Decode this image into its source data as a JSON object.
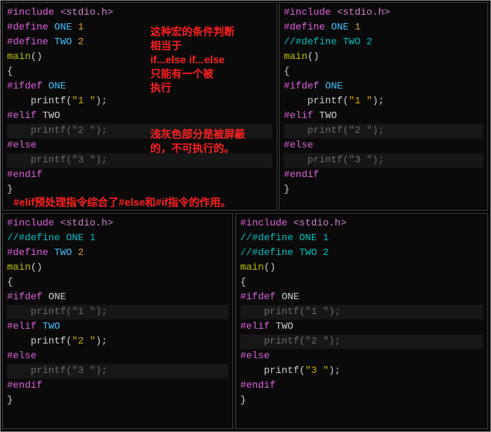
{
  "panel1": {
    "l0_kw": "#include",
    "l0_inc": " <stdio.h>",
    "l1_kw": "#define",
    "l1_mac": " ONE",
    "l1_val": " 1",
    "l2_kw": "#define",
    "l2_mac": " TWO",
    "l2_val": " 2",
    "l3_fn": "main",
    "l3_paren": "()",
    "l4": "{",
    "l5_kw": "#ifdef",
    "l5_mac": " ONE",
    "l6_call": "    printf(",
    "l6_str": "\"1 \"",
    "l6_end": ");",
    "l7_kw": "#elif",
    "l7_mac": " TWO",
    "l8_dim": "    printf(\"2 \");",
    "l9_kw": "#else",
    "l10_dim": "    printf(\"3 \");",
    "l11_kw": "#endif",
    "l12": "}"
  },
  "panel2": {
    "l0_kw": "#include",
    "l0_inc": " <stdio.h>",
    "l1_kw": "#define",
    "l1_mac": " ONE",
    "l1_val": " 1",
    "l2_cmt": "//#define TWO 2",
    "l3_fn": "main",
    "l3_paren": "()",
    "l4": "{",
    "l5_kw": "#ifdef",
    "l5_mac": " ONE",
    "l6_call": "    printf(",
    "l6_str": "\"1 \"",
    "l6_end": ");",
    "l7_kw": "#elif",
    "l7_mac": " TWO",
    "l8_dim": "    printf(\"2 \");",
    "l9_kw": "#else",
    "l10_dim": "    printf(\"3 \");",
    "l11_kw": "#endif",
    "l12": "}"
  },
  "panel3": {
    "l0_kw": "#include",
    "l0_inc": " <stdio.h>",
    "l1_cmt": "//#define ONE 1",
    "l2_kw": "#define",
    "l2_mac": " TWO",
    "l2_val": " 2",
    "l3_fn": "main",
    "l3_paren": "()",
    "l4": "{",
    "l5_kw": "#ifdef",
    "l5_mac": " ONE",
    "l6_dim": "    printf(\"1 \");",
    "l7_kw": "#elif",
    "l7_mac": " TWO",
    "l8_call": "    printf(",
    "l8_str": "\"2 \"",
    "l8_end": ");",
    "l9_kw": "#else",
    "l10_dim": "    printf(\"3 \");",
    "l11_kw": "#endif",
    "l12": "}"
  },
  "panel4": {
    "l0_kw": "#include",
    "l0_inc": " <stdio.h>",
    "l1_cmt": "//#define ONE 1",
    "l2_cmt": "//#define TWO 2",
    "l3_fn": "main",
    "l3_paren": "()",
    "l4": "{",
    "l5_kw": "#ifdef",
    "l5_txt": " ONE",
    "l6_dim": "    printf(\"1 \");",
    "l7_kw": "#elif",
    "l7_txt": " TWO",
    "l8_dim": "    printf(\"2 \");",
    "l9_kw": "#else",
    "l10_call": "    printf(",
    "l10_str": "\"3 \"",
    "l10_end": ");",
    "l11_kw": "#endif",
    "l12": "}"
  },
  "notes": {
    "n1": "这种宏的条件判断\n相当于\nif...else if...else\n只能有一个被\n执行",
    "n2": "浅灰色部分是被屏蔽\n的，不可执行的。",
    "n3": "#elif预处理指令综合了#else和#if指令的作用。"
  }
}
